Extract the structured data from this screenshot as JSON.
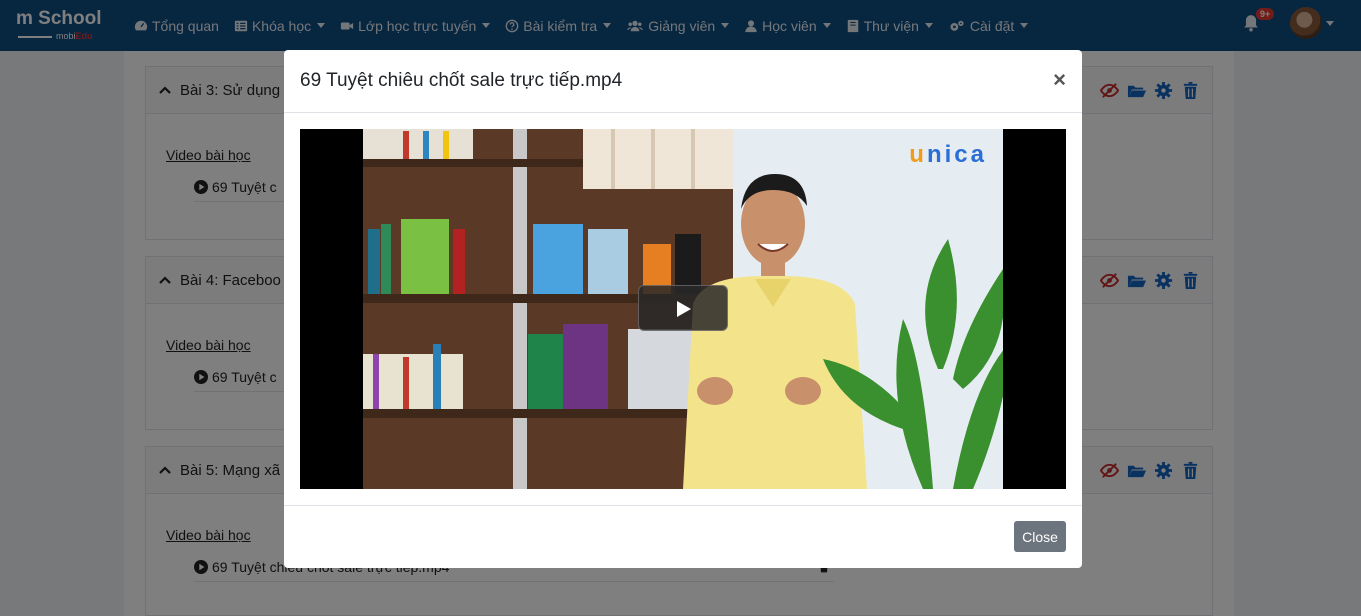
{
  "brand": {
    "name": "m School",
    "sub_prefix": "mobi",
    "sub_suffix": "Edu"
  },
  "nav": {
    "items": [
      {
        "label": "Tổng quan",
        "icon": "dashboard-icon",
        "dropdown": false
      },
      {
        "label": "Khóa học",
        "icon": "list-icon",
        "dropdown": true
      },
      {
        "label": "Lớp học trực tuyến",
        "icon": "video-camera-icon",
        "dropdown": true
      },
      {
        "label": "Bài kiểm tra",
        "icon": "question-circle-icon",
        "dropdown": true
      },
      {
        "label": "Giảng viên",
        "icon": "users-icon",
        "dropdown": true
      },
      {
        "label": "Học viên",
        "icon": "user-icon",
        "dropdown": true
      },
      {
        "label": "Thư viện",
        "icon": "book-icon",
        "dropdown": true
      },
      {
        "label": "Cài đặt",
        "icon": "cogs-icon",
        "dropdown": true
      }
    ],
    "notification_badge": "9+"
  },
  "lessons": [
    {
      "title": "Bài 3: Sử dụng",
      "video_label": "Video bài học",
      "video_item": "69 Tuyệt c"
    },
    {
      "title": "Bài 4: Faceboo",
      "video_label": "Video bài học",
      "video_item": "69 Tuyệt c"
    },
    {
      "title": "Bài 5: Mạng xã",
      "video_label": "Video bài học",
      "video_item": "69 Tuyệt chiêu chốt sale trực tiếp.mp4"
    }
  ],
  "modal": {
    "title": "69 Tuyệt chiêu chốt sale trực tiếp.mp4",
    "close_symbol": "×",
    "close_button": "Close",
    "video_brand": "unica"
  },
  "colors": {
    "navbar": "#0f4c81",
    "action_blue": "#1565c0",
    "hide_red": "#c62828",
    "close_button": "#6c757d"
  }
}
